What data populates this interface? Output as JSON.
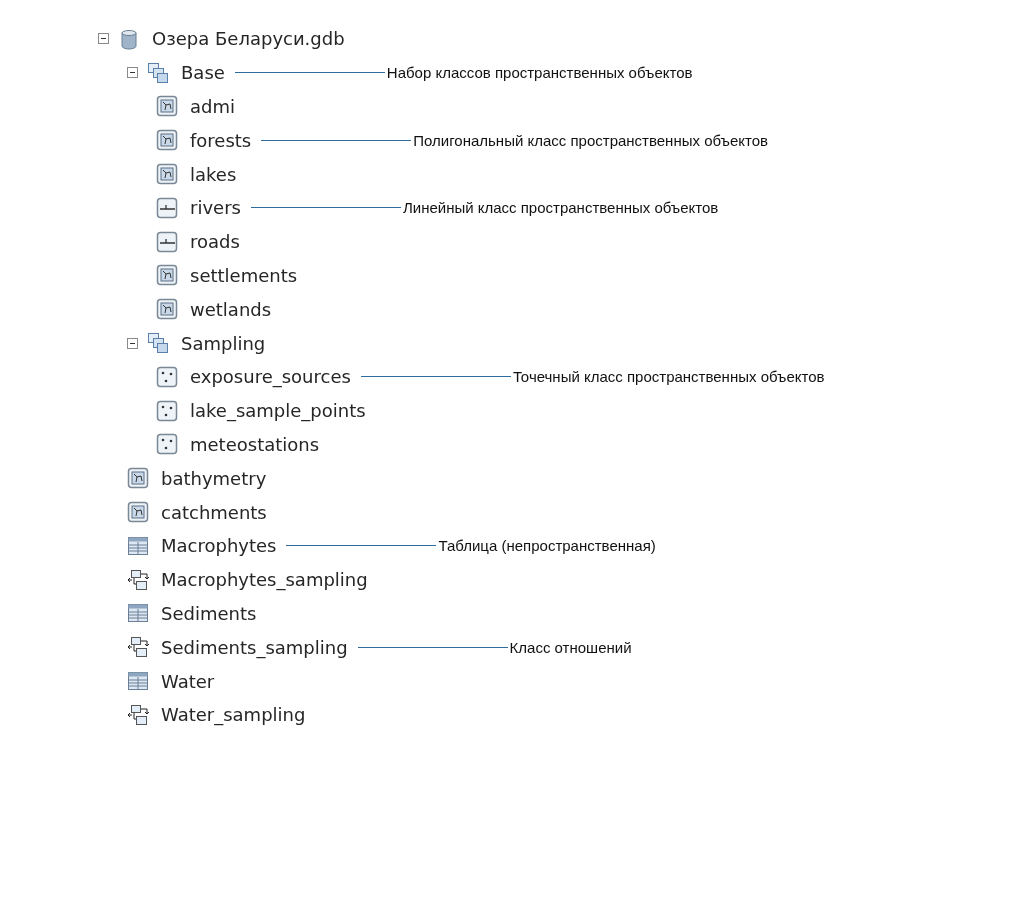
{
  "tree": [
    {
      "label": "Озера Беларуси.gdb",
      "kind": "database",
      "expanded": true,
      "children": [
        {
          "label": "Base",
          "kind": "dataset",
          "expanded": true,
          "note": "Набор классов пространственных объектов",
          "children": [
            {
              "label": "admi",
              "kind": "polygon"
            },
            {
              "label": "forests",
              "kind": "polygon",
              "note": "Полигональный класс пространственных объектов"
            },
            {
              "label": "lakes",
              "kind": "polygon"
            },
            {
              "label": "rivers",
              "kind": "line",
              "note": "Линейный класс пространственных объектов"
            },
            {
              "label": "roads",
              "kind": "line"
            },
            {
              "label": "settlements",
              "kind": "polygon"
            },
            {
              "label": "wetlands",
              "kind": "polygon"
            }
          ]
        },
        {
          "label": "Sampling",
          "kind": "dataset",
          "expanded": true,
          "children": [
            {
              "label": "exposure_sources",
              "kind": "point",
              "note": "Точечный класс пространственных объектов"
            },
            {
              "label": "lake_sample_points",
              "kind": "point"
            },
            {
              "label": "meteostations",
              "kind": "point"
            }
          ]
        },
        {
          "label": "bathymetry",
          "kind": "polygon"
        },
        {
          "label": "catchments",
          "kind": "polygon"
        },
        {
          "label": "Macrophytes",
          "kind": "table",
          "note": "Таблица (непространственная)"
        },
        {
          "label": "Macrophytes_sampling",
          "kind": "relationship"
        },
        {
          "label": "Sediments",
          "kind": "table"
        },
        {
          "label": "Sediments_sampling",
          "kind": "relationship",
          "note": "Класс отношений"
        },
        {
          "label": "Water",
          "kind": "table"
        },
        {
          "label": "Water_sampling",
          "kind": "relationship"
        }
      ]
    }
  ]
}
